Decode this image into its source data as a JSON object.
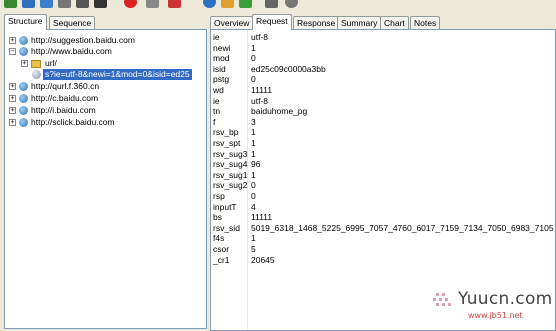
{
  "left_tabs": [
    "Structure",
    "Sequence"
  ],
  "right_tabs": [
    "Overview",
    "Request",
    "Response",
    "Summary",
    "Chart",
    "Notes"
  ],
  "tree": {
    "n1": "http://suggestion.baidu.com",
    "n2": "http://www.baidu.com",
    "n3": "url/",
    "n4": "s?ie=utf-8&newi=1&mod=0&isid=ed25",
    "n5": "http://qurl.f.360.cn",
    "n6": "http://c.baidu.com",
    "n7": "http://i.baidu.com",
    "n8": "http://sclick.baidu.com"
  },
  "request_params": [
    {
      "name": "ie",
      "value": "utf-8"
    },
    {
      "name": "newi",
      "value": "1"
    },
    {
      "name": "mod",
      "value": "0"
    },
    {
      "name": "isid",
      "value": "ed25c09c0000a3bb"
    },
    {
      "name": "pstg",
      "value": "0"
    },
    {
      "name": "wd",
      "value": "11111"
    },
    {
      "name": "ie",
      "value": "utf-8"
    },
    {
      "name": "tn",
      "value": "baiduhome_pg"
    },
    {
      "name": "f",
      "value": "3"
    },
    {
      "name": "rsv_bp",
      "value": "1"
    },
    {
      "name": "rsv_spt",
      "value": "1"
    },
    {
      "name": "rsv_sug3",
      "value": "1"
    },
    {
      "name": "rsv_sug4",
      "value": "96"
    },
    {
      "name": "rsv_sug1",
      "value": "1"
    },
    {
      "name": "rsv_sug2",
      "value": "0"
    },
    {
      "name": "rsp",
      "value": "0"
    },
    {
      "name": "inputT",
      "value": "4"
    },
    {
      "name": "bs",
      "value": "11111"
    },
    {
      "name": "rsv_sid",
      "value": "5019_6318_1468_5225_6995_7057_4760_6017_7159_7134_7050_6983_7105"
    },
    {
      "name": "f4s",
      "value": "1"
    },
    {
      "name": "csor",
      "value": "5"
    },
    {
      "name": "_cr1",
      "value": "20645"
    }
  ],
  "watermark": {
    "main": "Yuucn.com",
    "sub": "www.jb51.net"
  },
  "colors": {
    "selection": "#316ac5",
    "panel_bg": "#ece9d8",
    "border": "#7f9db9"
  }
}
